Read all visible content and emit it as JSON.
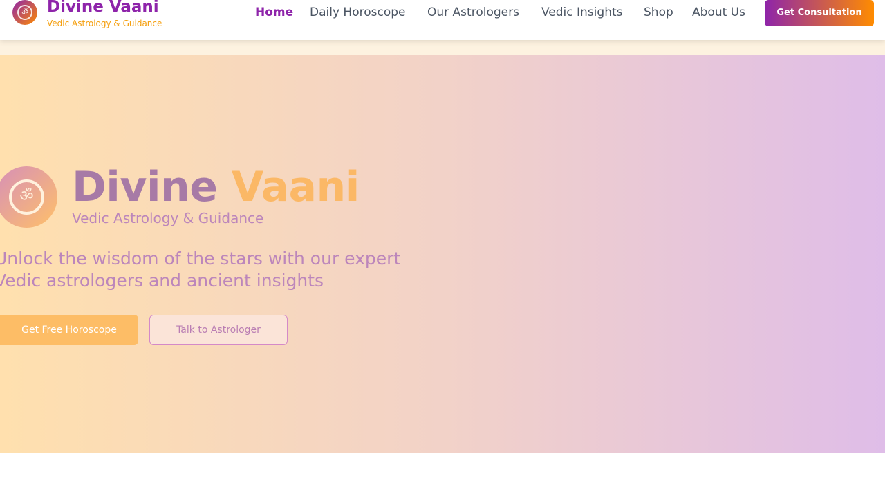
{
  "header": {
    "logo_icon": "om-icon",
    "logo_glyph": "ॐ",
    "brand_name": "Divine Vaani",
    "brand_tagline": "Vedic Astrology & Guidance",
    "nav": [
      {
        "label": "Home",
        "active": true
      },
      {
        "label": "Daily Horoscope",
        "active": false
      },
      {
        "label": "Our Astrologers",
        "active": false
      },
      {
        "label": "Vedic Insights",
        "active": false
      },
      {
        "label": "Shop",
        "active": false
      },
      {
        "label": "About Us",
        "active": false
      }
    ],
    "cta_label": "Get Consultation"
  },
  "hero": {
    "logo_icon": "om-icon",
    "logo_glyph": "ॐ",
    "title_part1": "Divine",
    "title_part2": "Vaani",
    "subtitle": "Vedic Astrology & Guidance",
    "tagline": "Unlock the wisdom of the stars with our expert Vedic astrologers and ancient insights",
    "primary_button": "Get Free Horoscope",
    "secondary_button": "Talk to Astrologer"
  },
  "colors": {
    "brand_purple": "#8e24aa",
    "brand_orange": "#ff8c00",
    "tagline_amber": "#f59e0b",
    "nav_text": "#4b5563"
  }
}
